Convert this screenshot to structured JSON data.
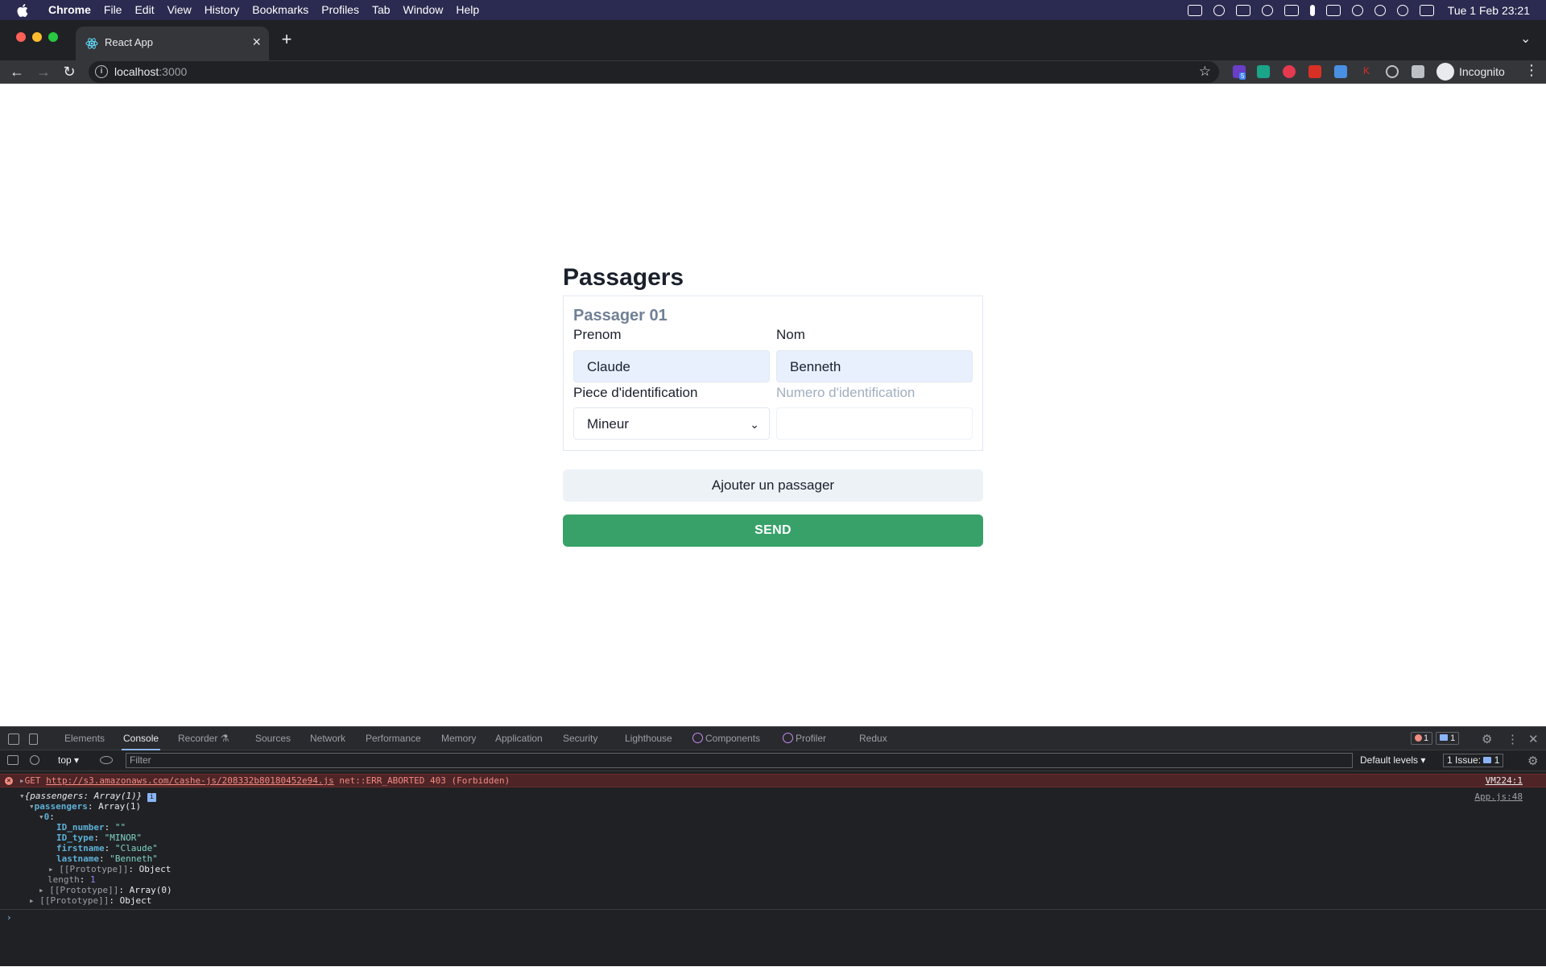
{
  "menubar": {
    "app_name": "Chrome",
    "items": [
      "File",
      "Edit",
      "View",
      "History",
      "Bookmarks",
      "Profiles",
      "Tab",
      "Window",
      "Help"
    ],
    "clock": "Tue 1 Feb  23:21"
  },
  "browser": {
    "tab_title": "React App",
    "tab_close": "×",
    "new_tab": "+",
    "url_host": "localhost",
    "url_port": ":3000",
    "profile_label": "Incognito",
    "extension_badge": "5"
  },
  "page": {
    "title": "Passagers",
    "passenger": {
      "heading": "Passager 01",
      "firstname_label": "Prenom",
      "lastname_label": "Nom",
      "firstname_value": "Claude",
      "lastname_value": "Benneth",
      "id_type_label": "Piece d'identification",
      "id_number_placeholder": "Numero d'identification",
      "id_type_value": "Mineur",
      "id_number_value": ""
    },
    "add_button": "Ajouter un passager",
    "send_button": "SEND"
  },
  "devtools": {
    "tabs": [
      "Elements",
      "Console",
      "Recorder",
      "Sources",
      "Network",
      "Performance",
      "Memory",
      "Application",
      "Security",
      "Lighthouse",
      "Components",
      "Profiler",
      "Redux"
    ],
    "active_tab": "Console",
    "error_count": "1",
    "message_count": "1",
    "context": "top ▾",
    "filter_placeholder": "Filter",
    "levels": "Default levels ▾",
    "issues": "1 Issue:",
    "issues_count": "1"
  },
  "console": {
    "error": {
      "method": "GET",
      "url": "http://s3.amazonaws.com/cashe-js/208332b80180452e94.js",
      "message": "net::ERR_ABORTED 403 (Forbidden)",
      "source": "VM224:1"
    },
    "log_source": "App.js:48",
    "lines": [
      {
        "text": "{passengers: Array(1)}"
      },
      {
        "key": "passengers",
        "value": "Array(1)"
      },
      {
        "key": "0",
        "value": ""
      },
      {
        "key": "ID_number",
        "value": "\"\""
      },
      {
        "key": "ID_type",
        "value": "\"MINOR\""
      },
      {
        "key": "firstname",
        "value": "\"Claude\""
      },
      {
        "key": "lastname",
        "value": "\"Benneth\""
      },
      {
        "key": "[[Prototype]]",
        "value": "Object"
      },
      {
        "key": "length",
        "value": "1"
      },
      {
        "key": "[[Prototype]]",
        "value": "Array(0)"
      },
      {
        "key": "[[Prototype]]",
        "value": "Object"
      }
    ],
    "prompt": "›"
  },
  "colors": {
    "send_button": "#38a169",
    "menubar_bg": "#2b2a50",
    "input_filled_bg": "#e8f0fe"
  }
}
